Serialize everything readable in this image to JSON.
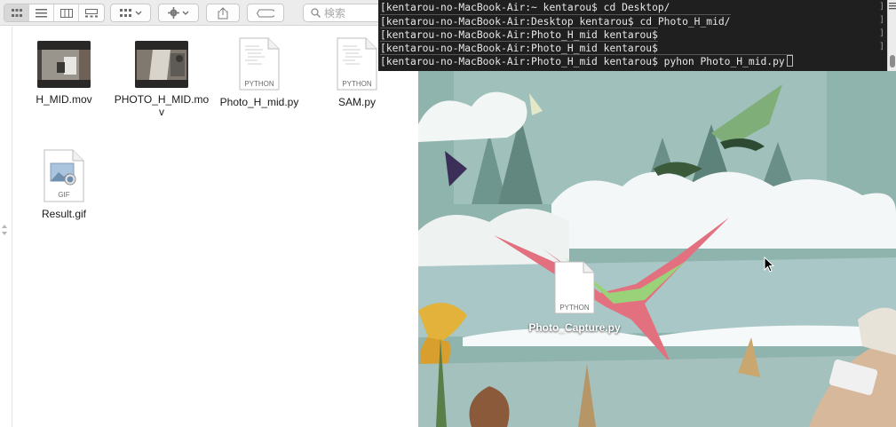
{
  "finder": {
    "search_placeholder": "検索",
    "files": [
      {
        "name": "H_MID.mov",
        "kind": "video-thumbnail"
      },
      {
        "name": "PHOTO_H_MID.mov",
        "kind": "video-thumbnail"
      },
      {
        "name": "Photo_H_mid.py",
        "kind": "python-document",
        "badge": "PYTHON"
      },
      {
        "name": "SAM.py",
        "kind": "python-document",
        "badge": "PYTHON"
      },
      {
        "name": "Result.gif",
        "kind": "gif-document",
        "badge": "GIF"
      }
    ]
  },
  "terminal": {
    "lines": [
      "kentarou-no-MacBook-Air:~ kentarou$ cd Desktop/",
      "kentarou-no-MacBook-Air:Desktop kentarou$ cd Photo_H_mid/",
      "kentarou-no-MacBook-Air:Photo_H_mid kentarou$",
      "kentarou-no-MacBook-Air:Photo_H_mid kentarou$",
      "kentarou-no-MacBook-Air:Photo_H_mid kentarou$ pyhon Photo_H_mid.py"
    ]
  },
  "desktop": {
    "file": {
      "name": "Photo_Capture.py",
      "badge": "PYTHON"
    }
  },
  "colors": {
    "finder_bg": "#ffffff",
    "toolbar_bg": "#ececec",
    "terminal_bg": "#161616",
    "terminal_text": "#e8e8e8",
    "wallpaper_sky": "#8fb3ad"
  }
}
